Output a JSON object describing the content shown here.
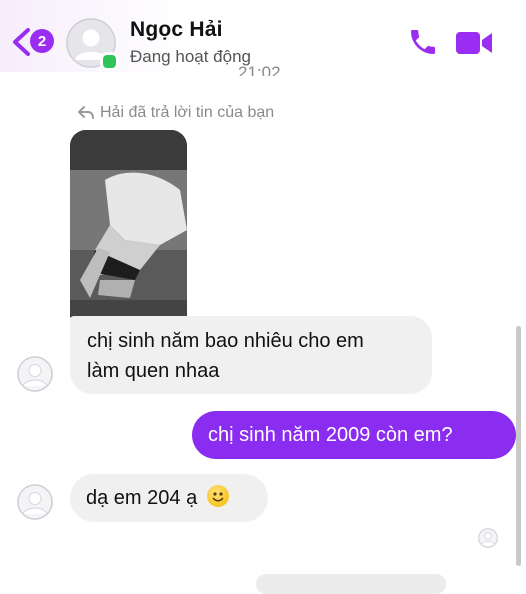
{
  "header": {
    "back_badge": "2",
    "contact_name": "Ngọc Hải",
    "status": "Đang hoạt động",
    "accent_color": "#9b2df2",
    "online_color": "#2fc55c"
  },
  "conversation": {
    "timestamp": "21:02",
    "reply_note": "Hải đã trả lời tin của bạn",
    "messages": [
      {
        "from": "contact",
        "text_line1": "chị sinh năm bao nhiêu cho em",
        "text_line2": "làm quen nhaa"
      },
      {
        "from": "me",
        "text": "chị sinh năm 2009 còn em?"
      },
      {
        "from": "contact",
        "text": "dạ em 204 ạ",
        "emoji": "slightly-smiling-face"
      }
    ]
  },
  "icons": [
    "back-chevron-icon",
    "phone-icon",
    "video-camera-icon",
    "reply-arrow-icon",
    "smiley-emoji-icon"
  ]
}
